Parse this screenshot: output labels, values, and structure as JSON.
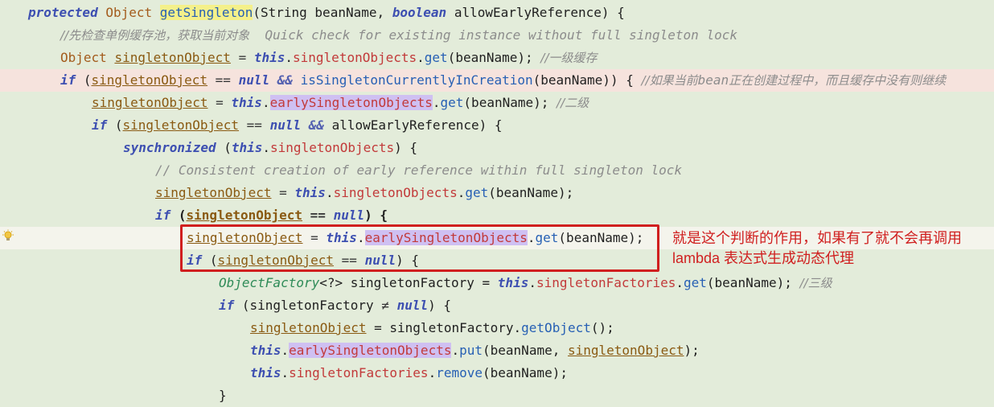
{
  "code": {
    "l1": {
      "a": "protected",
      "b": " Object ",
      "c": "getSingleton",
      "d": "(String beanName, ",
      "e": "boolean",
      "f": " allowEarlyReference) {"
    },
    "l2": {
      "a": "//先检查单例缓存池，获取当前对象",
      "b": "  Quick check for existing instance without full singleton lock"
    },
    "l3": {
      "a": "Object ",
      "b": "singletonObject",
      "c": " = ",
      "d": "this",
      "e": ".",
      "f": "singletonObjects",
      "g": ".",
      "h": "get",
      "i": "(beanName); ",
      "j": "//一级缓存"
    },
    "l4": {
      "a": "if",
      "b": " (",
      "c": "singletonObject",
      "d": " == ",
      "e": "null",
      "f": " && ",
      "g": "isSingletonCurrentlyInCreation",
      "h": "(beanName)) { ",
      "i": "//如果当前",
      "j": "bean",
      "k": "正在创建过程中，而且缓存中没有则继续"
    },
    "l5": {
      "a": "singletonObject",
      "b": " = ",
      "c": "this",
      "d": ".",
      "e": "earlySingletonObjects",
      "f": ".",
      "g": "get",
      "h": "(beanName); ",
      "i": "//二级"
    },
    "l6": {
      "a": "if",
      "b": " (",
      "c": "singletonObject",
      "d": " == ",
      "e": "null",
      "f": " && ",
      "g": "allowEarlyReference) {"
    },
    "l7": {
      "a": "synchronized",
      "b": " (",
      "c": "this",
      "d": ".",
      "e": "singletonObjects",
      "f": ") {"
    },
    "l8": {
      "a": "// Consistent creation of early reference within full singleton lock"
    },
    "l9": {
      "a": "singletonObject",
      "b": " = ",
      "c": "this",
      "d": ".",
      "e": "singletonObjects",
      "f": ".",
      "g": "get",
      "h": "(beanName);"
    },
    "l10": {
      "a": "if",
      "b": " (",
      "c": "singletonObject",
      "d": " == ",
      "e": "null",
      "f": ") {"
    },
    "l11": {
      "a": "singletonObject",
      "b": " = ",
      "c": "this",
      "d": ".",
      "e": "earlySingletonObjects",
      "f": ".",
      "g": "get",
      "h": "(beanName);"
    },
    "l12": {
      "a": "if",
      "b": " (",
      "c": "singletonObject",
      "d": " == ",
      "e": "null",
      "f": ") {"
    },
    "l13": {
      "a": "ObjectFactory",
      "b": "<?> singletonFactory = ",
      "c": "this",
      "d": ".",
      "e": "singletonFactories",
      "f": ".",
      "g": "get",
      "h": "(beanName); ",
      "i": "//三级"
    },
    "l14": {
      "a": "if",
      "b": " (singletonFactory ",
      "c": "≠",
      "d": " ",
      "e": "null",
      "f": ") {"
    },
    "l15": {
      "a": "singletonObject",
      "b": " = singletonFactory.",
      "c": "getObject",
      "d": "();"
    },
    "l16": {
      "a": "this",
      "b": ".",
      "c": "earlySingletonObjects",
      "d": ".",
      "e": "put",
      "f": "(beanName, ",
      "g": "singletonObject",
      "h": ");"
    },
    "l17": {
      "a": "this",
      "b": ".",
      "c": "singletonFactories",
      "d": ".",
      "e": "remove",
      "f": "(beanName);"
    },
    "l18": {
      "a": "}"
    }
  },
  "annotation": {
    "text": "就是这个判断的作用，如果有了就不会再调用 lambda 表达式生成动态代理"
  },
  "icons": {
    "gutter": "lightbulb-icon"
  },
  "colors": {
    "background": "#e3ecda",
    "annotation": "#d01f1f",
    "keyword": "#3d4fb1",
    "field": "#c23a3a",
    "method": "#2760b4"
  }
}
